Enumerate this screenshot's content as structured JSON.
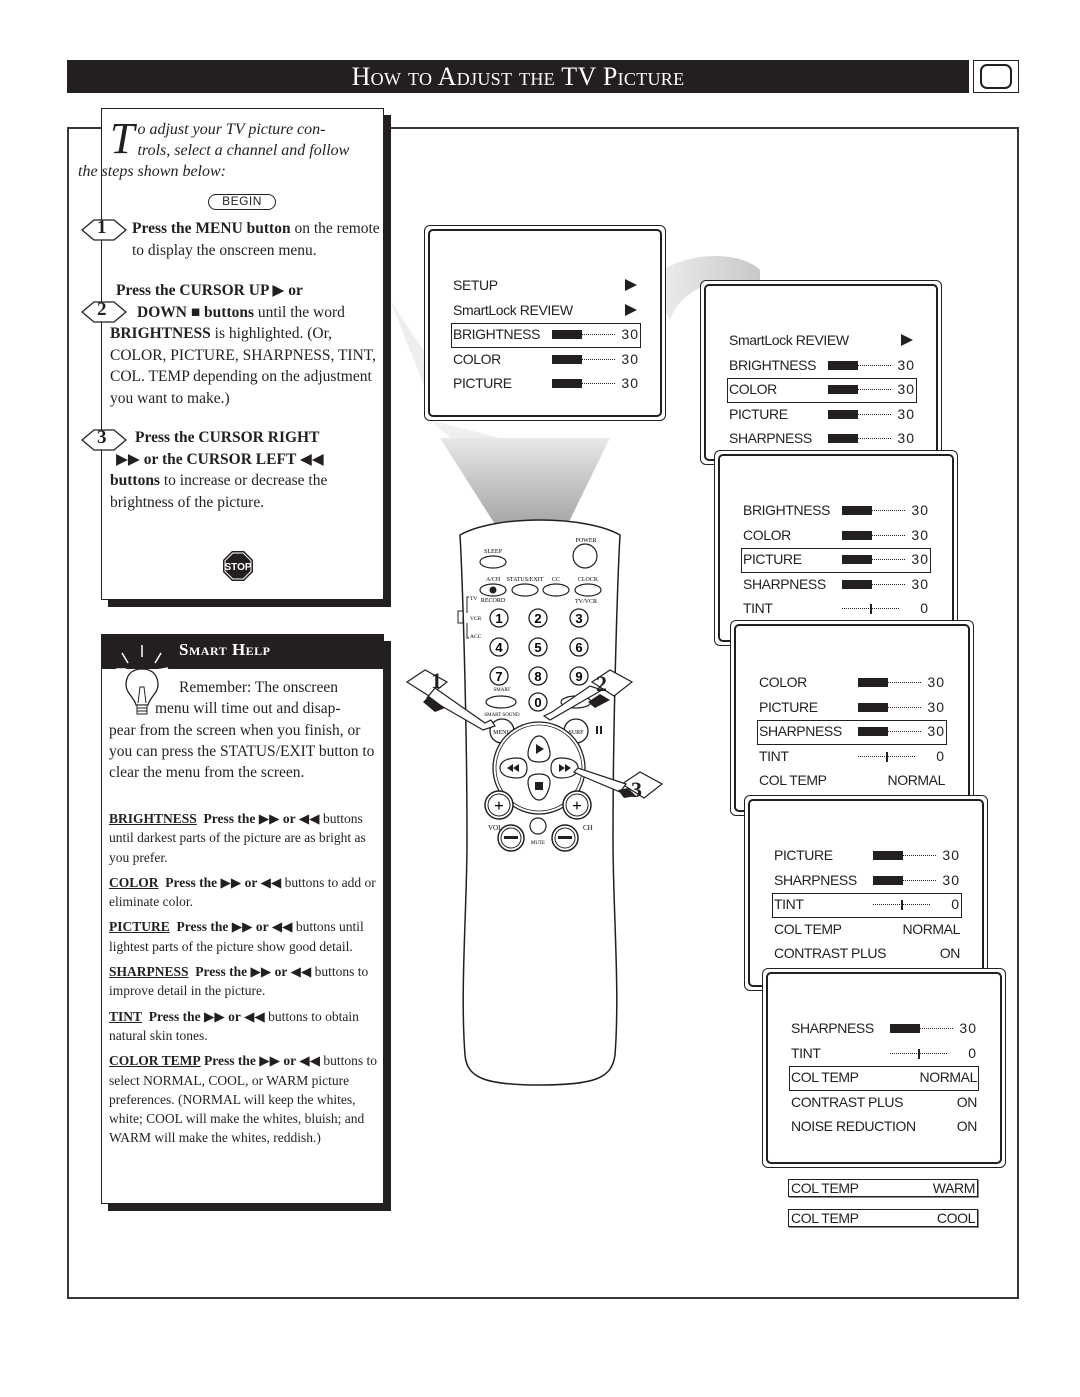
{
  "header": {
    "title": "How to Adjust the TV Picture",
    "icon": "tv-screen-icon"
  },
  "intro": {
    "dropcap": "T",
    "text": "o adjust your TV picture controls, select a channel and follow the steps shown below:",
    "line1": "o adjust your TV picture con-",
    "line2": "trols, select a channel and follow",
    "line3": "the steps shown below:",
    "begin_label": "BEGIN"
  },
  "steps": [
    {
      "number": "1",
      "bold": "Press the MENU button",
      "text": " on the remote to display the onscreen menu."
    },
    {
      "number": "2",
      "line1_bold": "Press the CURSOR UP ▶ or",
      "line2_bold": "DOWN ■ buttons",
      "line2_text": " until the word",
      "line3_bold": "BRIGHTNESS",
      "line3_text": " is highlighted. (Or,",
      "rest": "COLOR, PICTURE, SHARPNESS, TINT, COL. TEMP depending on the adjustment you want to make.)"
    },
    {
      "number": "3",
      "line1_bold": "Press the CURSOR RIGHT",
      "line2_bold": "▶▶ or the CURSOR LEFT ◀◀",
      "line3_bold": "buttons",
      "line3_text": " to increase or decrease the",
      "line4": "brightness of the picture."
    }
  ],
  "stop_label": "STOP",
  "smart_help": {
    "title": "Smart Help",
    "line1": "Remember: The onscreen",
    "line2": "menu will time out and disap-",
    "rest": "pear from the screen when you finish, or you can press the STATUS/EXIT button to clear the menu from the screen.",
    "tips": [
      {
        "keyword": "BRIGHTNESS",
        "press": "Press the ▶▶ or ◀◀",
        "text": " buttons until darkest parts of the picture are as bright as you prefer."
      },
      {
        "keyword": "COLOR",
        "press": "Press the ▶▶ or ◀◀",
        "text": " buttons to add or eliminate color."
      },
      {
        "keyword": "PICTURE",
        "press": "Press the ▶▶ or ◀◀",
        "text": " buttons until lightest parts of the picture show good detail."
      },
      {
        "keyword": "SHARPNESS",
        "press": "Press the ▶▶ or ◀◀",
        "text": " buttons to improve detail in the picture."
      },
      {
        "keyword": "TINT",
        "press": "Press the ▶▶ or ◀◀",
        "text": " buttons to obtain natural skin tones."
      },
      {
        "keyword": "COLOR TEMP",
        "press": "Press the ▶▶ or ◀◀",
        "text": " buttons to select NORMAL, COOL, or WARM picture preferences. (NORMAL will keep the whites, white; COOL will make the whites, bluish; and WARM will make the whites, reddish.)"
      }
    ]
  },
  "menu_screens": [
    {
      "rows": [
        {
          "label": "SETUP",
          "type": "arrow"
        },
        {
          "label": "SmartLock REVIEW",
          "type": "arrow"
        },
        {
          "label": "BRIGHTNESS",
          "type": "bar",
          "value": "30",
          "level": 0.55,
          "highlighted": true
        },
        {
          "label": "COLOR",
          "type": "bar",
          "value": "30",
          "level": 0.55
        },
        {
          "label": "PICTURE",
          "type": "bar",
          "value": "30",
          "level": 0.55
        }
      ]
    },
    {
      "rows": [
        {
          "label": "SmartLock REVIEW",
          "type": "arrow"
        },
        {
          "label": "BRIGHTNESS",
          "type": "bar",
          "value": "30",
          "level": 0.55
        },
        {
          "label": "COLOR",
          "type": "bar",
          "value": "30",
          "level": 0.55,
          "highlighted": true
        },
        {
          "label": "PICTURE",
          "type": "bar",
          "value": "30",
          "level": 0.55
        },
        {
          "label": "SHARPNESS",
          "type": "bar",
          "value": "30",
          "level": 0.55
        }
      ]
    },
    {
      "rows": [
        {
          "label": "BRIGHTNESS",
          "type": "bar",
          "value": "30",
          "level": 0.55
        },
        {
          "label": "COLOR",
          "type": "bar",
          "value": "30",
          "level": 0.55
        },
        {
          "label": "PICTURE",
          "type": "bar",
          "value": "30",
          "level": 0.55,
          "highlighted": true
        },
        {
          "label": "SHARPNESS",
          "type": "bar",
          "value": "30",
          "level": 0.55
        },
        {
          "label": "TINT",
          "type": "center",
          "value": "0",
          "level": 0.5
        }
      ]
    },
    {
      "rows": [
        {
          "label": "COLOR",
          "type": "bar",
          "value": "30",
          "level": 0.55
        },
        {
          "label": "PICTURE",
          "type": "bar",
          "value": "30",
          "level": 0.55
        },
        {
          "label": "SHARPNESS",
          "type": "bar",
          "value": "30",
          "level": 0.55,
          "highlighted": true
        },
        {
          "label": "TINT",
          "type": "center",
          "value": "0",
          "level": 0.5
        },
        {
          "label": "COL TEMP",
          "type": "text",
          "value": "NORMAL"
        }
      ]
    },
    {
      "rows": [
        {
          "label": "PICTURE",
          "type": "bar",
          "value": "30",
          "level": 0.55
        },
        {
          "label": "SHARPNESS",
          "type": "bar",
          "value": "30",
          "level": 0.55
        },
        {
          "label": "TINT",
          "type": "center",
          "value": "0",
          "level": 0.5,
          "highlighted": true
        },
        {
          "label": "COL TEMP",
          "type": "text",
          "value": "NORMAL"
        },
        {
          "label": "CONTRAST PLUS",
          "type": "text",
          "value": "ON"
        }
      ]
    },
    {
      "rows": [
        {
          "label": "SHARPNESS",
          "type": "bar",
          "value": "30",
          "level": 0.55
        },
        {
          "label": "TINT",
          "type": "center",
          "value": "0",
          "level": 0.5
        },
        {
          "label": "COL TEMP",
          "type": "text",
          "value": "NORMAL",
          "highlighted": true
        },
        {
          "label": "CONTRAST PLUS",
          "type": "text",
          "value": "ON"
        },
        {
          "label": "NOISE REDUCTION",
          "type": "text",
          "value": "ON"
        }
      ]
    }
  ],
  "col_temp_options": [
    {
      "label": "COL TEMP",
      "value": "WARM"
    },
    {
      "label": "COL TEMP",
      "value": "COOL"
    }
  ],
  "remote": {
    "power": "POWER",
    "sleep": "SLEEP",
    "ach": "A/CH",
    "status_exit": "STATUS/EXIT",
    "cc": "CC",
    "clock": "CLOCK",
    "record": "RECORD",
    "tv_vcr": "TV/VCR",
    "mode_tv": "TV",
    "mode_vcr": "VCR",
    "mode_acc": "ACC",
    "digits": [
      "1",
      "2",
      "3",
      "4",
      "5",
      "6",
      "7",
      "8",
      "9",
      "0"
    ],
    "smart_sound": "SMART SOUND",
    "smart_picture": "SMART",
    "menu": "MENU",
    "surf": "SURF",
    "vol": "VOL",
    "ch": "CH",
    "mute": "MUTE",
    "plus": "+",
    "minus": "−"
  },
  "callouts": [
    "1",
    "2",
    "3"
  ]
}
